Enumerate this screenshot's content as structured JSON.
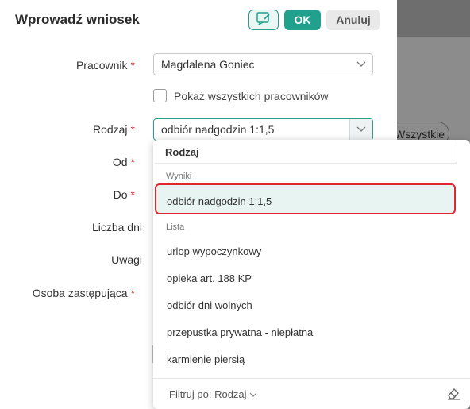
{
  "background": {
    "chip_label": "Wszystkie"
  },
  "modal": {
    "title": "Wprowadź wniosek",
    "icon_button": "sign-icon",
    "ok_label": "OK",
    "cancel_label": "Anuluj"
  },
  "form": {
    "required_mark": "*",
    "employee_label": "Pracownik",
    "employee_value": "Magdalena Goniec",
    "show_all_label": "Pokaż wszystkich pracowników",
    "show_all_checked": false,
    "type_label": "Rodzaj",
    "type_value": "odbiór nadgodzin 1:1,5",
    "from_label": "Od",
    "to_label": "Do",
    "days_label": "Liczba dni",
    "notes_label": "Uwagi",
    "substitute_label": "Osoba zastępująca"
  },
  "dropdown": {
    "search_value": "Rodzaj",
    "results_header": "Wyniki",
    "results": [
      "odbiór nadgodzin 1:1,5"
    ],
    "list_header": "Lista",
    "list": [
      "urlop wypoczynkowy",
      "opieka art. 188 KP",
      "odbiór dni wolnych",
      "przepustka prywatna - niepłatna",
      "karmienie piersią"
    ],
    "filter_label": "Filtruj po: Rodzaj",
    "clear_icon": "eraser-icon"
  },
  "colors": {
    "accent": "#21a08d",
    "required": "#d9363e",
    "highlight": "#e0262e"
  }
}
